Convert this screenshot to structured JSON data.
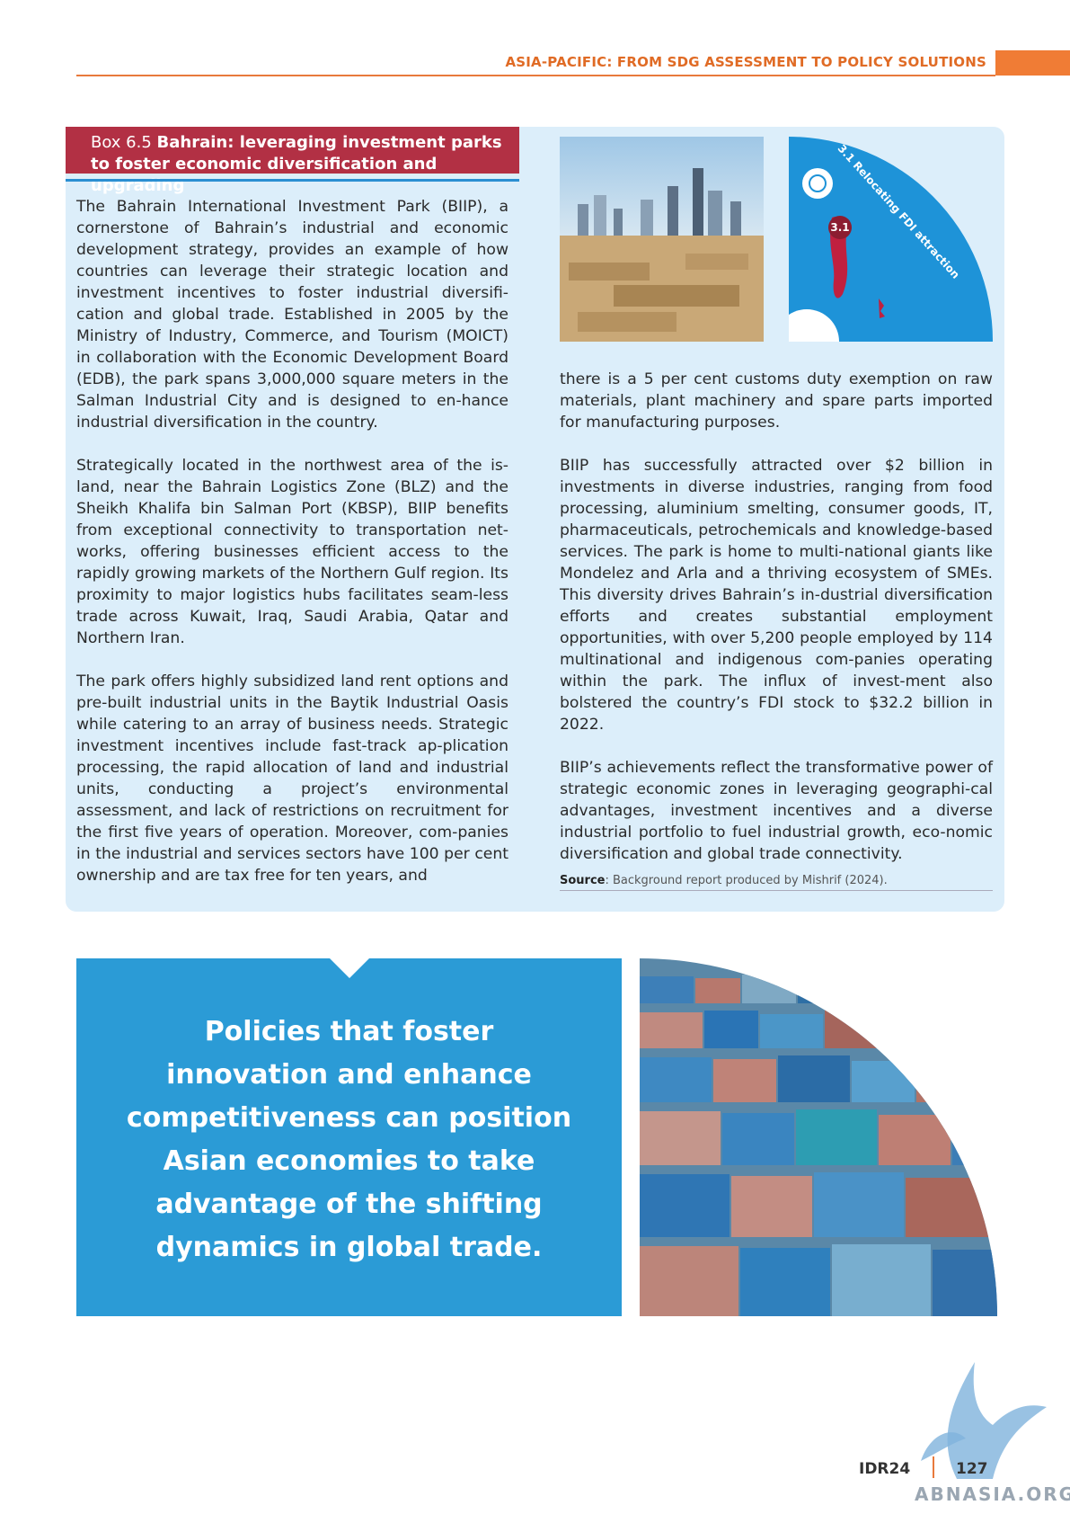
{
  "header": {
    "title": "ASIA-PACIFIC: FROM SDG ASSESSMENT TO POLICY SOLUTIONS"
  },
  "box": {
    "label": "Box 6.5",
    "title": "Bahrain: leveraging investment parks to foster economic diversification and upgrading",
    "left_paragraphs": [
      "The Bahrain International Investment Park (BIIP), a cornerstone of Bahrain’s industrial and economic development strategy, provides an example of how countries can leverage their strategic location and investment incentives to foster industrial diversifi-cation and global trade. Established in 2005 by the Ministry of Industry, Commerce, and Tourism (MOICT) in collaboration with the Economic Development Board (EDB), the park spans 3,000,000 square meters in the Salman Industrial City and is designed to en-hance industrial diversification in the country.",
      "Strategically located in the northwest area of the is-land, near the Bahrain Logistics Zone (BLZ) and the Sheikh Khalifa bin Salman Port (KBSP), BIIP benefits from exceptional connectivity to transportation net-works, offering businesses efficient access to the rapidly growing markets of the Northern Gulf region. Its proximity to major logistics hubs facilitates seam-less trade across Kuwait, Iraq, Saudi Arabia, Qatar and Northern Iran.",
      "The park offers highly subsidized land rent options and pre-built industrial units in the Baytik Industrial Oasis while catering to an array of business needs. Strategic investment incentives include fast-track ap-plication processing, the rapid allocation of land and industrial units, conducting a project’s environmental assessment, and lack of restrictions on recruitment for the first five years of operation. Moreover, com-panies in the industrial and services sectors have 100 per cent ownership and are tax free for ten years, and"
    ],
    "right_paragraphs": [
      "there is a 5 per cent customs duty exemption on raw materials, plant machinery and spare parts imported for manufacturing purposes.",
      "BIIP has successfully attracted over $2 billion in investments in diverse industries, ranging from food processing, aluminium smelting, consumer goods, IT, pharmaceuticals, petrochemicals and knowledge-based services. The park is home to multi-national giants like Mondelez and Arla and a thriving ecosystem of SMEs. This diversity drives Bahrain’s in-dustrial diversification efforts and creates substantial employment opportunities, with over 5,200 people employed by 114 multinational and indigenous com-panies operating within the park. The influx of invest-ment also bolstered the country’s FDI stock to $32.2 billion in 2022.",
      "BIIP’s achievements reflect the transformative power of strategic economic zones in leveraging geographi-cal advantages, investment incentives and a diverse industrial portfolio to fuel industrial growth, eco-nomic diversification and global trade connectivity."
    ],
    "source_label": "Source",
    "source_text": ": Background report produced by Mishrif (2024).",
    "map_badge": "3.1",
    "map_arc_text": "3.1 Relocating FDI attraction"
  },
  "quote": {
    "text": "Policies that foster innovation and enhance competitiveness can position Asian economies to take advantage of the shifting dynamics in global trade."
  },
  "footer": {
    "doc": "IDR24",
    "page": "127",
    "watermark": "ABNASIA.ORG"
  },
  "colors": {
    "accent_orange": "#e87a3c",
    "box_bg": "#dceefa",
    "title_red": "#b23044",
    "quote_blue": "#2b9bd6"
  }
}
